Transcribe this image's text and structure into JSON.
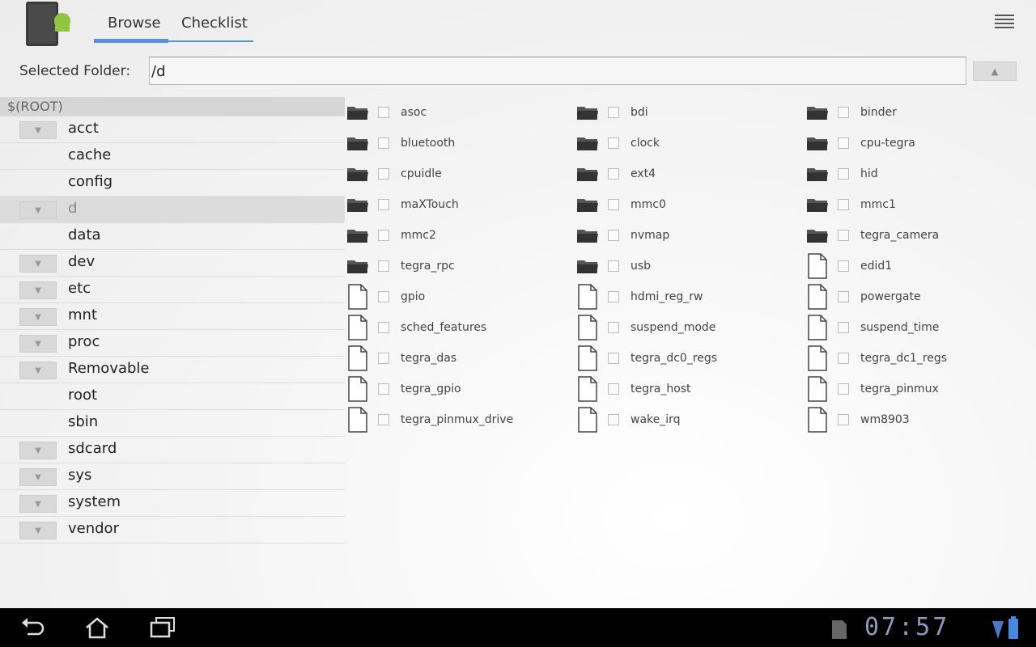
{
  "header": {
    "tabs": [
      {
        "label": "Browse",
        "selected": true
      },
      {
        "label": "Checklist",
        "selected": false
      }
    ],
    "accent": "#5b8ee0",
    "logo_icon": "android-sdcard-icon",
    "menu_icon": "menu-icon"
  },
  "folder": {
    "label": "Selected Folder:",
    "value": "/d",
    "up_icon": "chevron-up-icon"
  },
  "tree": {
    "root": "$(ROOT)",
    "items": [
      {
        "name": "acct",
        "expandable": true
      },
      {
        "name": "cache",
        "expandable": false
      },
      {
        "name": "config",
        "expandable": false
      },
      {
        "name": "d",
        "expandable": true,
        "selected": true
      },
      {
        "name": "data",
        "expandable": false
      },
      {
        "name": "dev",
        "expandable": true
      },
      {
        "name": "etc",
        "expandable": true
      },
      {
        "name": "mnt",
        "expandable": true
      },
      {
        "name": "proc",
        "expandable": true
      },
      {
        "name": "Removable",
        "expandable": true
      },
      {
        "name": "root",
        "expandable": false
      },
      {
        "name": "sbin",
        "expandable": false
      },
      {
        "name": "sdcard",
        "expandable": true
      },
      {
        "name": "sys",
        "expandable": true
      },
      {
        "name": "system",
        "expandable": true
      },
      {
        "name": "vendor",
        "expandable": true
      }
    ]
  },
  "entries": [
    {
      "name": "asoc",
      "type": "folder"
    },
    {
      "name": "bdi",
      "type": "folder"
    },
    {
      "name": "binder",
      "type": "folder"
    },
    {
      "name": "bluetooth",
      "type": "folder"
    },
    {
      "name": "clock",
      "type": "folder"
    },
    {
      "name": "cpu-tegra",
      "type": "folder"
    },
    {
      "name": "cpuidle",
      "type": "folder"
    },
    {
      "name": "ext4",
      "type": "folder"
    },
    {
      "name": "hid",
      "type": "folder"
    },
    {
      "name": "maXTouch",
      "type": "folder"
    },
    {
      "name": "mmc0",
      "type": "folder"
    },
    {
      "name": "mmc1",
      "type": "folder"
    },
    {
      "name": "mmc2",
      "type": "folder"
    },
    {
      "name": "nvmap",
      "type": "folder"
    },
    {
      "name": "tegra_camera",
      "type": "folder"
    },
    {
      "name": "tegra_rpc",
      "type": "folder"
    },
    {
      "name": "usb",
      "type": "folder"
    },
    {
      "name": "edid1",
      "type": "file"
    },
    {
      "name": "gpio",
      "type": "file"
    },
    {
      "name": "hdmi_reg_rw",
      "type": "file"
    },
    {
      "name": "powergate",
      "type": "file"
    },
    {
      "name": "sched_features",
      "type": "file"
    },
    {
      "name": "suspend_mode",
      "type": "file"
    },
    {
      "name": "suspend_time",
      "type": "file"
    },
    {
      "name": "tegra_das",
      "type": "file"
    },
    {
      "name": "tegra_dc0_regs",
      "type": "file"
    },
    {
      "name": "tegra_dc1_regs",
      "type": "file"
    },
    {
      "name": "tegra_gpio",
      "type": "file"
    },
    {
      "name": "tegra_host",
      "type": "file"
    },
    {
      "name": "tegra_pinmux",
      "type": "file"
    },
    {
      "name": "tegra_pinmux_drive",
      "type": "file"
    },
    {
      "name": "wake_irq",
      "type": "file"
    },
    {
      "name": "wm8903",
      "type": "file"
    }
  ],
  "statusbar": {
    "time": "07:57",
    "icons": [
      "back-icon",
      "home-icon",
      "recent-apps-icon",
      "sdcard-icon",
      "signal-icon",
      "battery-icon"
    ]
  }
}
